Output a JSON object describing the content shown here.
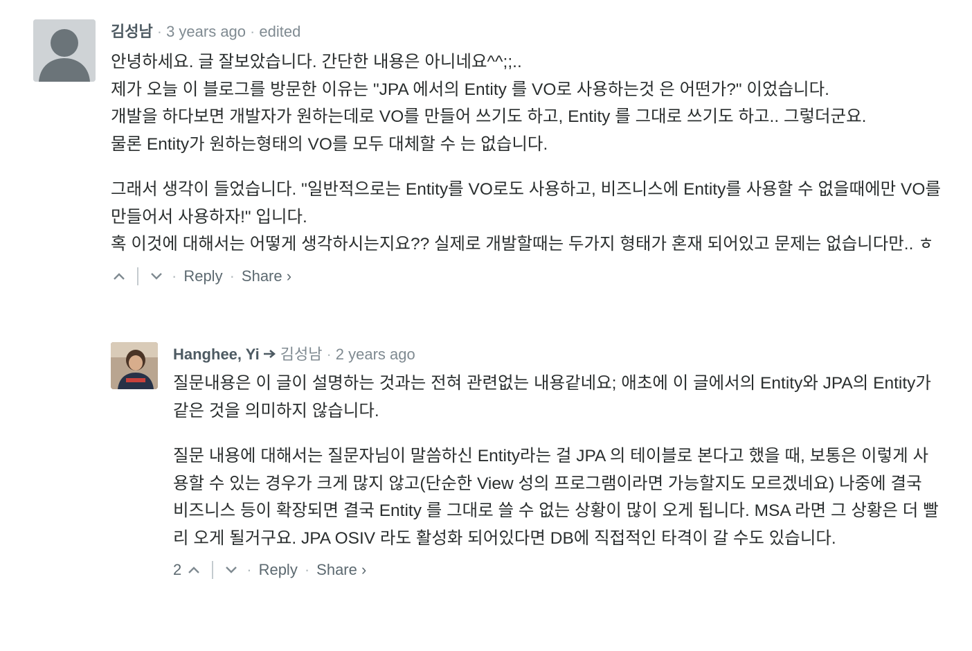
{
  "comments": [
    {
      "author": "김성남",
      "time": "3 years ago",
      "edited": "edited",
      "paragraphs": [
        [
          "안녕하세요. 글 잘보았습니다. 간단한 내용은 아니네요^^;;..",
          "제가 오늘 이 블로그를 방문한 이유는 \"JPA 에서의 Entity 를 VO로 사용하는것 은 어떤가?\" 이었습니다.",
          "개발을 하다보면 개발자가 원하는데로 VO를 만들어 쓰기도 하고, Entity 를 그대로 쓰기도 하고.. 그렇더군요.",
          "물론 Entity가 원하는형태의 VO를 모두 대체할 수 는 없습니다."
        ],
        [
          "그래서 생각이 들었습니다. \"일반적으로는 Entity를 VO로도 사용하고, 비즈니스에 Entity를 사용할 수 없을때에만 VO를 만들어서 사용하자!\" 입니다.",
          "혹 이것에 대해서는 어떻게 생각하시는지요?? 실제로 개발할때는 두가지 형태가 혼재 되어있고 문제는 없습니다만.. ㅎ"
        ]
      ],
      "votes": "",
      "reply": "Reply",
      "share": "Share ›"
    },
    {
      "author": "Hanghee, Yi",
      "reply_to": "김성남",
      "time": "2 years ago",
      "paragraphs": [
        [
          "질문내용은 이 글이 설명하는 것과는 전혀 관련없는 내용같네요; 애초에 이 글에서의 Entity와 JPA의 Entity가 같은 것을 의미하지 않습니다."
        ],
        [
          "질문 내용에 대해서는 질문자님이 말씀하신 Entity라는 걸 JPA 의 테이블로 본다고 했을 때, 보통은 이렇게 사용할 수 있는 경우가 크게 많지 않고(단순한 View 성의 프로그램이라면 가능할지도 모르겠네요) 나중에 결국 비즈니스 등이 확장되면 결국 Entity 를 그대로 쓸 수 없는 상황이 많이 오게 됩니다. MSA 라면 그 상황은 더 빨리 오게 될거구요. JPA OSIV 라도 활성화 되어있다면 DB에 직접적인 타격이 갈 수도 있습니다."
        ]
      ],
      "votes": "2",
      "reply": "Reply",
      "share": "Share ›"
    }
  ],
  "icons": {
    "upvote": "chevron-up-icon",
    "downvote": "chevron-down-icon",
    "reply_arrow": "arrow-right-icon"
  }
}
